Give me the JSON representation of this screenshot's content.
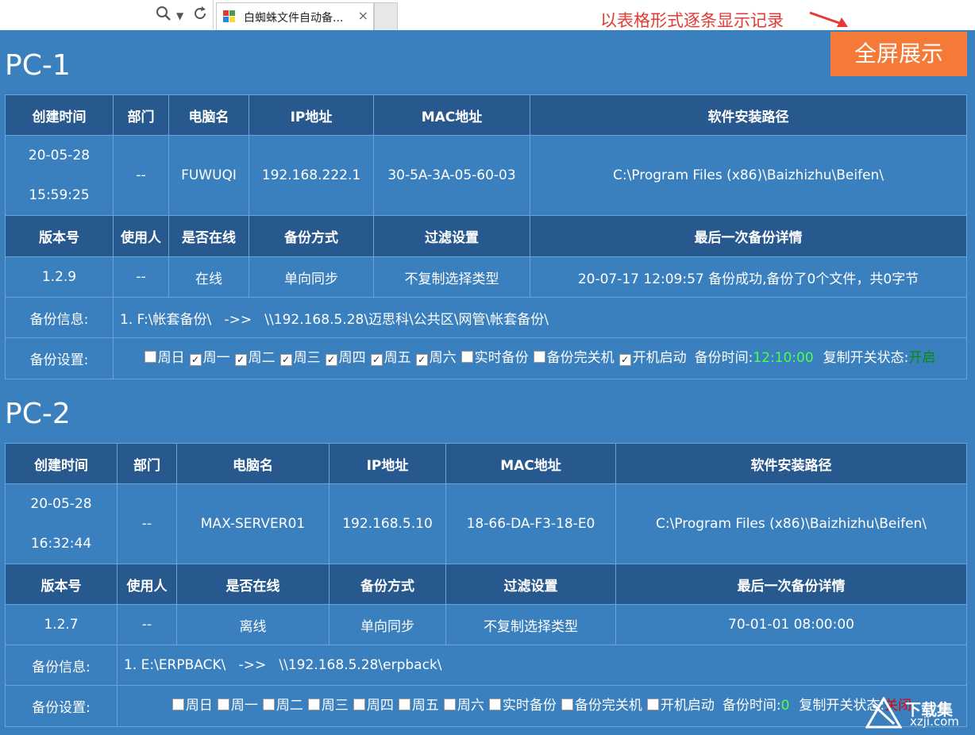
{
  "browser": {
    "tab_title": "白蜘蛛文件自动备...",
    "tab_close": "×"
  },
  "annotation": "以表格形式逐条显示记录",
  "fullscreen_button": "全屏展示",
  "pcs": [
    {
      "title": "PC-1",
      "headers1": [
        "创建时间",
        "部门",
        "电脑名",
        "IP地址",
        "MAC地址",
        "软件安装路径"
      ],
      "created_date": "20-05-28",
      "created_time": "15:59:25",
      "department": "--",
      "computer_name": "FUWUQI",
      "ip": "192.168.222.1",
      "mac": "30-5A-3A-05-60-03",
      "install_path": "C:\\Program Files (x86)\\Baizhizhu\\Beifen\\",
      "headers2": [
        "版本号",
        "使用人",
        "是否在线",
        "备份方式",
        "过滤设置",
        "最后一次备份详情"
      ],
      "version": "1.2.9",
      "user": "--",
      "online": "在线",
      "backup_mode": "单向同步",
      "filter": "不复制选择类型",
      "last_backup": "20-07-17 12:09:57 备份成功,备份了0个文件，共0字节",
      "backup_info_label": "备份信息:",
      "backup_info": "1. F:\\帐套备份\\   ->>   \\\\192.168.5.28\\迈思科\\公共区\\网管\\帐套备份\\",
      "backup_settings_label": "备份设置:",
      "settings": [
        {
          "label": "周日",
          "checked": false
        },
        {
          "label": "周一",
          "checked": true
        },
        {
          "label": "周二",
          "checked": true
        },
        {
          "label": "周三",
          "checked": true
        },
        {
          "label": "周四",
          "checked": true
        },
        {
          "label": "周五",
          "checked": true
        },
        {
          "label": "周六",
          "checked": true
        },
        {
          "label": "实时备份",
          "checked": false
        },
        {
          "label": "备份完关机",
          "checked": false
        },
        {
          "label": "开机启动",
          "checked": true
        }
      ],
      "backup_time_label": "备份时间:",
      "backup_time": "12:10:00",
      "switch_label": "复制开关状态:",
      "switch_state": "开启"
    },
    {
      "title": "PC-2",
      "headers1": [
        "创建时间",
        "部门",
        "电脑名",
        "IP地址",
        "MAC地址",
        "软件安装路径"
      ],
      "created_date": "20-05-28",
      "created_time": "16:32:44",
      "department": "--",
      "computer_name": "MAX-SERVER01",
      "ip": "192.168.5.10",
      "mac": "18-66-DA-F3-18-E0",
      "install_path": "C:\\Program Files (x86)\\Baizhizhu\\Beifen\\",
      "headers2": [
        "版本号",
        "使用人",
        "是否在线",
        "备份方式",
        "过滤设置",
        "最后一次备份详情"
      ],
      "version": "1.2.7",
      "user": "--",
      "online": "离线",
      "backup_mode": "单向同步",
      "filter": "不复制选择类型",
      "last_backup": "70-01-01 08:00:00",
      "backup_info_label": "备份信息:",
      "backup_info": "1. E:\\ERPBACK\\   ->>   \\\\192.168.5.28\\erpback\\",
      "backup_settings_label": "备份设置:",
      "settings": [
        {
          "label": "周日",
          "checked": false
        },
        {
          "label": "周一",
          "checked": false
        },
        {
          "label": "周二",
          "checked": false
        },
        {
          "label": "周三",
          "checked": false
        },
        {
          "label": "周四",
          "checked": false
        },
        {
          "label": "周五",
          "checked": false
        },
        {
          "label": "周六",
          "checked": false
        },
        {
          "label": "实时备份",
          "checked": false
        },
        {
          "label": "备份完关机",
          "checked": false
        },
        {
          "label": "开机启动",
          "checked": false
        }
      ],
      "backup_time_label": "备份时间:",
      "backup_time": "0",
      "switch_label": "复制开关状态:",
      "switch_state": "关闭"
    }
  ],
  "watermark": {
    "line1": "下载集",
    "line2": "xzji.com"
  },
  "colors": {
    "page_bg": "#3a7fbe",
    "header_bg": "#27598e",
    "button": "#f57a38",
    "annotation": "#e53935",
    "info_text": "#ffff4d"
  }
}
